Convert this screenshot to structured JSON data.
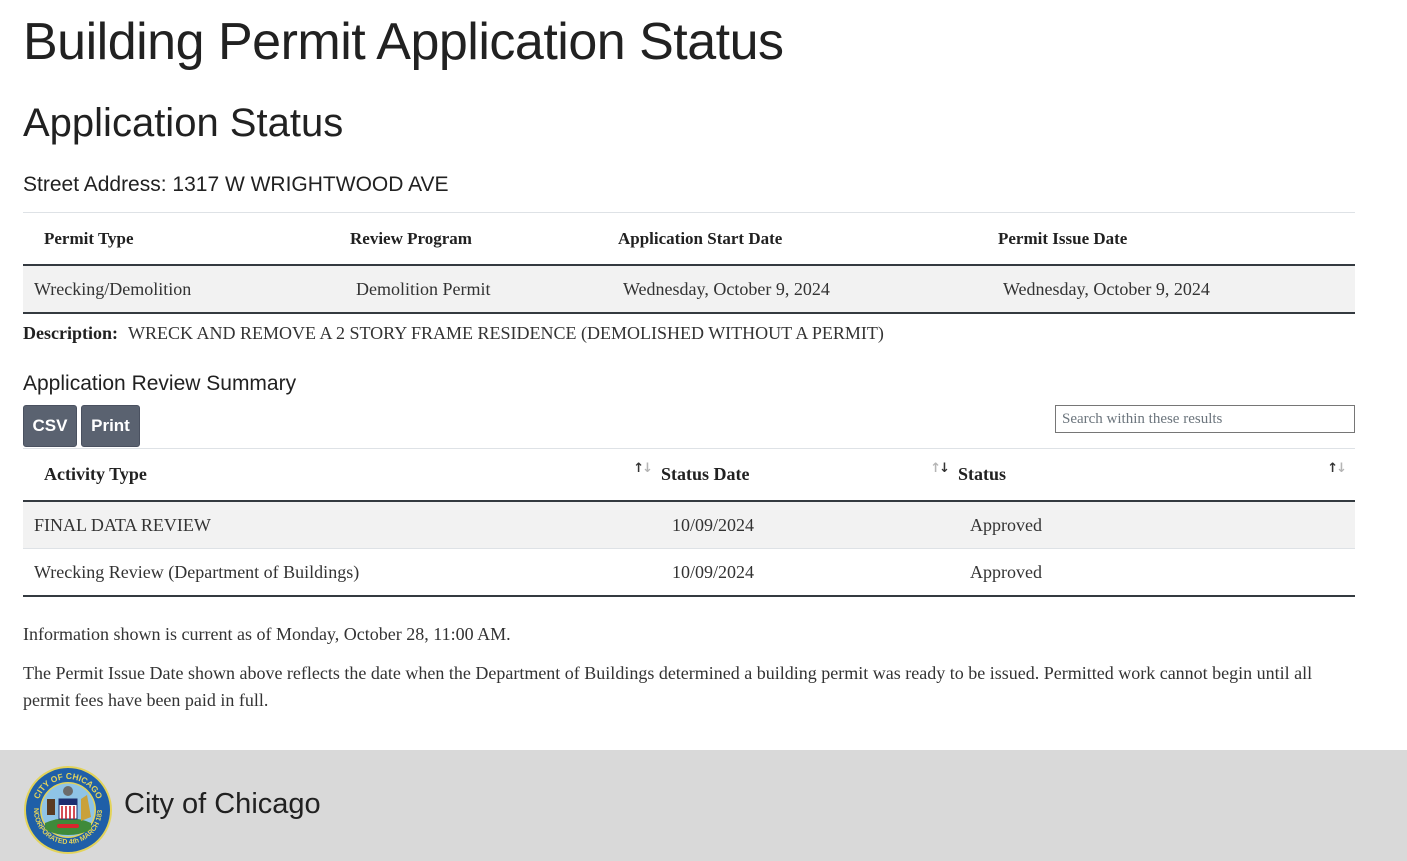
{
  "page": {
    "title": "Building Permit Application Status",
    "section_title": "Application Status",
    "street_address_label": "Street Address:",
    "street_address": "1317 W WRIGHTWOOD AVE",
    "street_address_full": "Street Address: 1317 W WRIGHTWOOD AVE"
  },
  "permit_table": {
    "headers": [
      "Permit Type",
      "Review Program",
      "Application Start Date",
      "Permit Issue Date"
    ],
    "rows": [
      [
        "Wrecking/Demolition",
        "Demolition Permit",
        "Wednesday, October 9, 2024",
        "Wednesday, October 9, 2024"
      ]
    ]
  },
  "description": {
    "label": "Description:",
    "text": "WRECK AND REMOVE A 2 STORY FRAME RESIDENCE (DEMOLISHED WITHOUT A PERMIT)"
  },
  "review_summary": {
    "title": "Application Review Summary",
    "csv_label": "CSV",
    "print_label": "Print",
    "search_placeholder": "Search within these results",
    "search_value": "",
    "sort_icon": "sort-up-down-icon",
    "headers": [
      "Activity Type",
      "Status Date",
      "Status"
    ],
    "rows": [
      [
        "FINAL DATA REVIEW",
        "10/09/2024",
        "Approved"
      ],
      [
        "Wrecking Review (Department of Buildings)",
        "10/09/2024",
        "Approved"
      ]
    ]
  },
  "notes": {
    "current_as_of": "Information shown is current as of Monday, October 28, 11:00 AM.",
    "issue_date_note": "The Permit Issue Date shown above reflects the date when the Department of Buildings determined a building permit was ready to be issued. Permitted work cannot begin until all permit fees have been paid in full."
  },
  "footer": {
    "title": "City of Chicago",
    "seal_icon": "city-seal-icon",
    "seal_text_top": "CITY OF CHICAGO",
    "seal_text_bottom": "INCORPORATED 4th MARCH 1837"
  },
  "colors": {
    "button_bg": "#5a6270",
    "footer_bg": "#d9d9d9",
    "row_stripe": "#f2f2f2",
    "seal_blue": "#1f5fa8",
    "seal_gold": "#e3d35a"
  }
}
